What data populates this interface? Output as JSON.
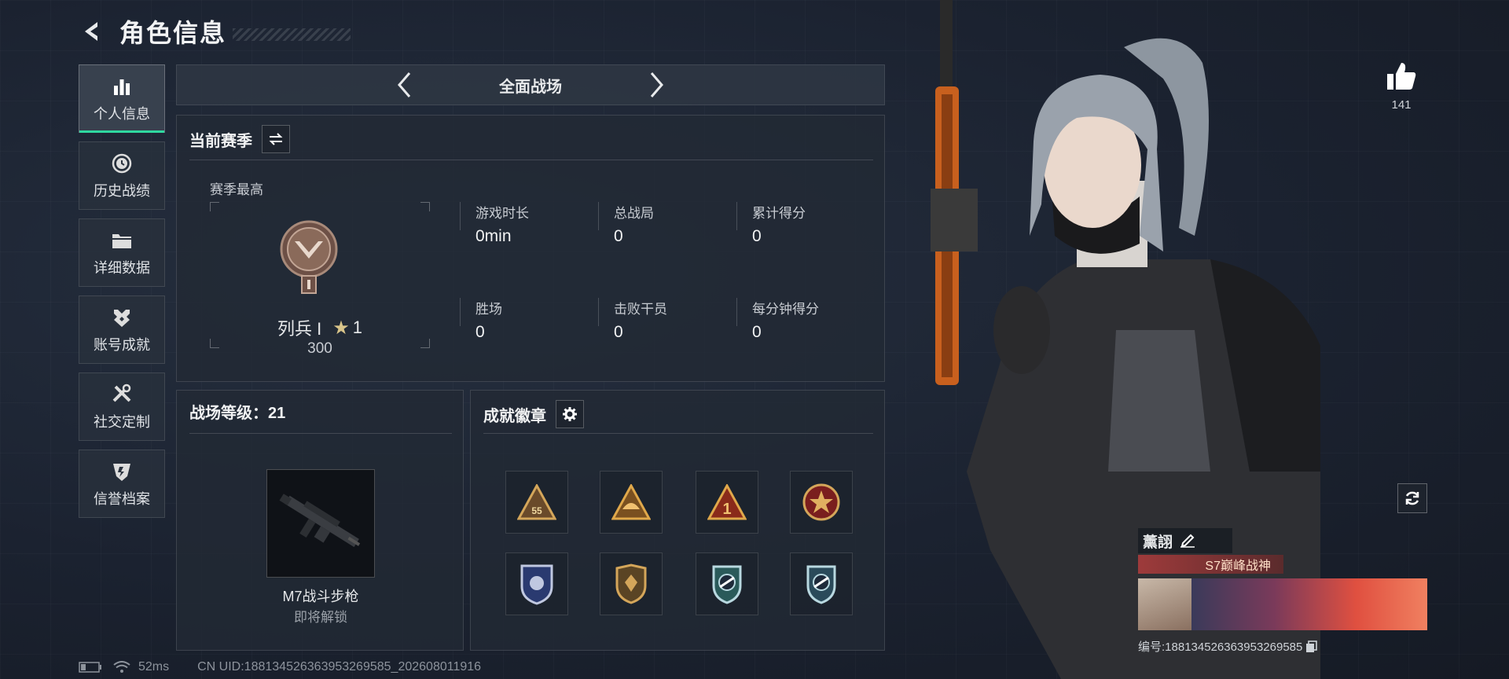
{
  "header": {
    "title": "角色信息"
  },
  "sidebar": {
    "items": [
      {
        "label": "个人信息",
        "icon": "bar-chart-icon",
        "active": true
      },
      {
        "label": "历史战绩",
        "icon": "history-icon"
      },
      {
        "label": "详细数据",
        "icon": "folder-icon"
      },
      {
        "label": "账号成就",
        "icon": "achievement-icon"
      },
      {
        "label": "社交定制",
        "icon": "tools-icon"
      },
      {
        "label": "信誉档案",
        "icon": "shield-icon"
      }
    ]
  },
  "mode_selector": {
    "current": "全面战场"
  },
  "season": {
    "header": "当前赛季",
    "best_label": "赛季最高",
    "rank_name": "列兵 I",
    "rank_stars": "1",
    "rank_points": "300",
    "stats": [
      {
        "label": "游戏时长",
        "value": "0min"
      },
      {
        "label": "总战局",
        "value": "0"
      },
      {
        "label": "累计得分",
        "value": "0"
      },
      {
        "label": "胜场",
        "value": "0"
      },
      {
        "label": "击败干员",
        "value": "0"
      },
      {
        "label": "每分钟得分",
        "value": "0"
      }
    ]
  },
  "battlefield_level": {
    "header": "战场等级：21",
    "weapon_name": "M7战斗步枪",
    "weapon_status": "即将解锁"
  },
  "badges": {
    "header": "成就徽章",
    "items": [
      "badge-55-triangle",
      "badge-helmet-triangle",
      "badge-1-triangle",
      "badge-star-medal",
      "badge-blue-shield",
      "badge-gold-shield",
      "badge-wing-shield",
      "badge-wing-shield-2"
    ]
  },
  "likes": {
    "count": "141"
  },
  "player_card": {
    "name": "薰詡",
    "title": "S7巅峰战神",
    "uid_line": "编号:1881345263639532695​85"
  },
  "footer": {
    "ping": "52ms",
    "uid": "CN UID:1881345263639532695​85_202608011916"
  },
  "colors": {
    "accent": "#2fd8a0",
    "rank_bronze": "#8a6a5a"
  }
}
